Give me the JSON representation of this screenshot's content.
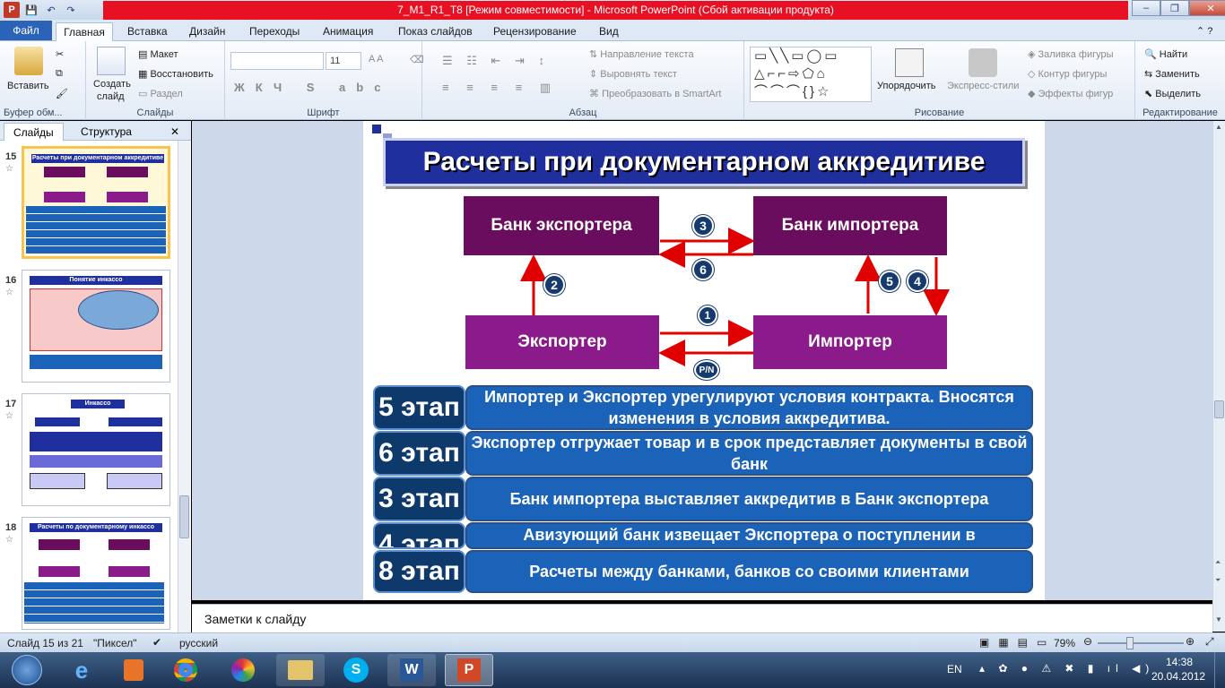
{
  "window": {
    "title": "7_M1_R1_T8 [Режим совместимости] - Microsoft PowerPoint (Сбой активации продукта)",
    "qat": {
      "save": "💾",
      "undo": "↶",
      "redo": "↷"
    }
  },
  "tabs": [
    "Файл",
    "Главная",
    "Вставка",
    "Дизайн",
    "Переходы",
    "Анимация",
    "Показ слайдов",
    "Рецензирование",
    "Вид"
  ],
  "ribbon": {
    "clipboard": {
      "paste": "Вставить",
      "label": "Буфер обм..."
    },
    "slides": {
      "new_slide": "Создать",
      "new_slide2": "слайд",
      "layout": "Макет",
      "reset": "Восстановить",
      "section": "Раздел",
      "label": "Слайды"
    },
    "font": {
      "size": "11",
      "label": "Шрифт"
    },
    "paragraph": {
      "direction": "Направление текста",
      "align": "Выровнять текст",
      "smartart": "Преобразовать в SmartArt",
      "label": "Абзац"
    },
    "drawing": {
      "arrange": "Упорядочить",
      "quick_styles": "Экспресс-стили",
      "fill": "Заливка фигуры",
      "outline": "Контур фигуры",
      "effects": "Эффекты фигур",
      "label": "Рисование"
    },
    "editing": {
      "find": "Найти",
      "replace": "Заменить",
      "select": "Выделить",
      "label": "Редактирование"
    }
  },
  "panel_tabs": {
    "slides": "Слайды",
    "outline": "Структура"
  },
  "thumbnails": [
    {
      "num": "15",
      "title": "Расчеты при документарном аккредитиве"
    },
    {
      "num": "16",
      "title": "Понятие инкассо"
    },
    {
      "num": "17",
      "title": "Инкассо"
    },
    {
      "num": "18",
      "title": "Расчеты по документарному инкассо"
    }
  ],
  "slide": {
    "title": "Расчеты при документарном аккредитиве",
    "bank_exporter": "Банк экспортера",
    "bank_importer": "Банк импортера",
    "exporter": "Экспортер",
    "importer": "Импортер",
    "badges": {
      "b1": "1",
      "b2": "2",
      "b3": "3",
      "b4": "4",
      "b5": "5",
      "b6": "6",
      "pn": "P/N"
    },
    "stages": [
      {
        "label": "5 этап",
        "text": "Импортер и Экспортер урегулируют условия контракта. Вносятся изменения в условия аккредитива."
      },
      {
        "label": "6 этап",
        "text": "Экспортер отгружает товар и в срок представляет документы в свой банк"
      },
      {
        "label": "3 этап",
        "text": "Банк импортера выставляет аккредитив в Банк экспортера"
      },
      {
        "label": "4 этап",
        "text": "Авизующий банк извещает Экспортера о поступлении в"
      },
      {
        "label": "8 этап",
        "text": "Расчеты между банками, банков со своими клиентами"
      }
    ]
  },
  "notes_placeholder": "Заметки к слайду",
  "status": {
    "slide": "Слайд 15 из 21",
    "theme": "\"Пиксел\"",
    "lang": "русский",
    "zoom": "79%"
  },
  "tray": {
    "lang": "EN",
    "time": "14:38",
    "date": "20.04.2012"
  },
  "colors": {
    "accent_blue": "#1b63b8",
    "purple_dark": "#6a0d5e",
    "purple": "#8b1a8b",
    "title_blue": "#1f2f9e"
  }
}
